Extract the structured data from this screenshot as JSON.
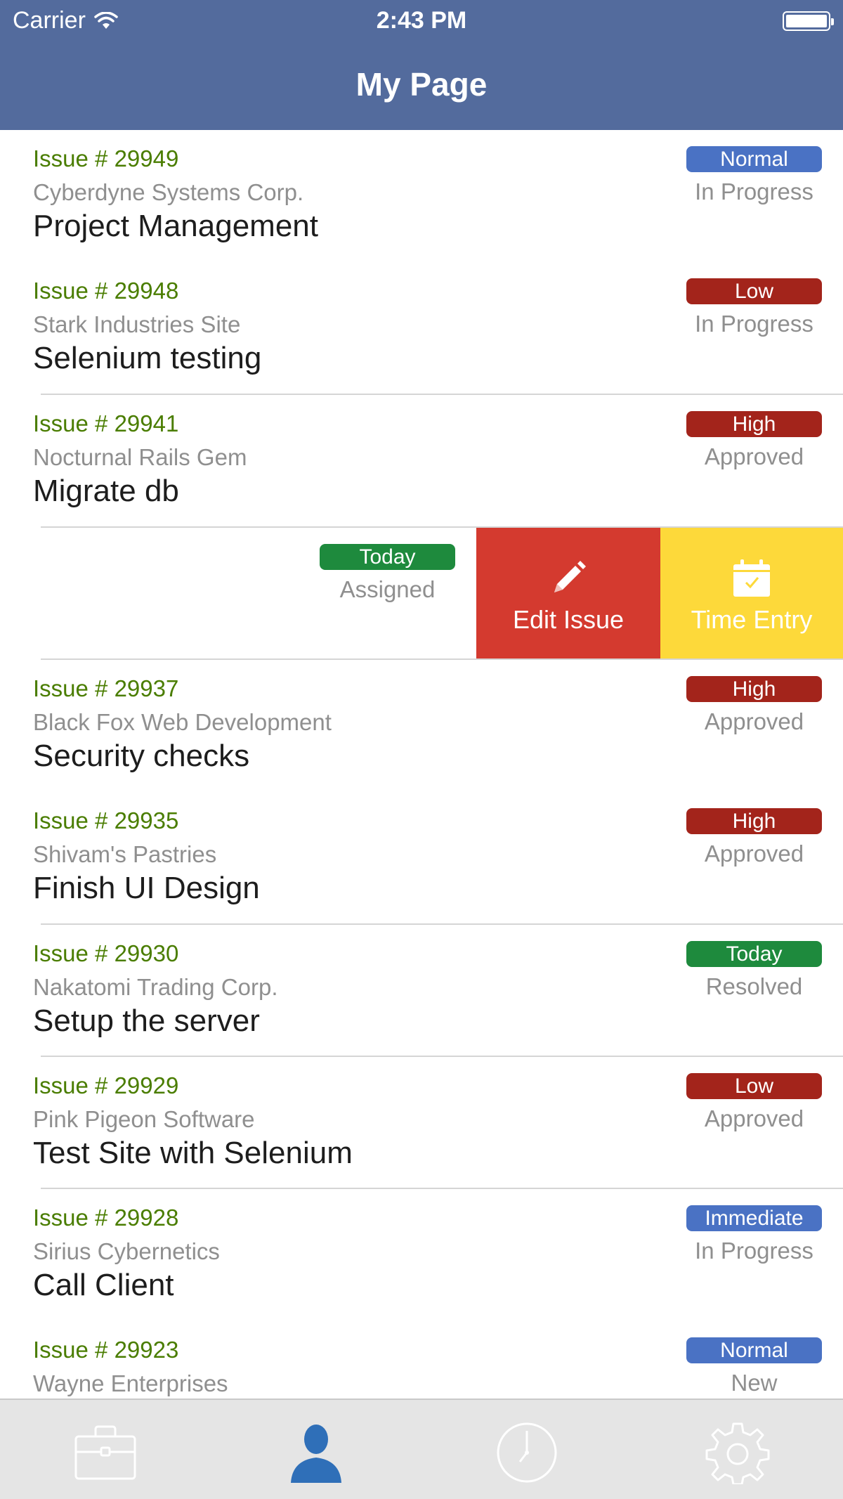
{
  "status_bar": {
    "carrier": "Carrier",
    "time": "2:43 PM"
  },
  "nav": {
    "title": "My Page"
  },
  "colors": {
    "header": "#536b9d",
    "issue_number": "#4a7d00",
    "badge_normal": "#4a72c4",
    "badge_low": "#a3241b",
    "badge_high": "#a3241b",
    "badge_today": "#1e8a3d",
    "badge_immediate": "#4a72c4",
    "edit_action": "#d43a2f",
    "time_action": "#fdd93a",
    "tab_active": "#2f6fb8",
    "tab_inactive": "#ffffff"
  },
  "issues": [
    {
      "number": "Issue # 29949",
      "company": "Cyberdyne Systems Corp.",
      "subject": "Project Management",
      "badge": "Normal",
      "badge_color": "#4a72c4",
      "status": "In Progress"
    },
    {
      "number": "Issue # 29948",
      "company": "Stark Industries Site",
      "subject": "Selenium testing",
      "badge": "Low",
      "badge_color": "#a3241b",
      "status": "In Progress"
    },
    {
      "number": "Issue # 29941",
      "company": "Nocturnal Rails Gem",
      "subject": "Migrate db",
      "badge": "High",
      "badge_color": "#a3241b",
      "status": "Approved"
    },
    {
      "badge": "Today",
      "badge_color": "#1e8a3d",
      "status": "Assigned",
      "swiped": true
    },
    {
      "number": "Issue # 29937",
      "company": "Black Fox Web Development",
      "subject": "Security checks",
      "badge": "High",
      "badge_color": "#a3241b",
      "status": "Approved"
    },
    {
      "number": "Issue # 29935",
      "company": "Shivam's Pastries",
      "subject": "Finish UI Design",
      "badge": "High",
      "badge_color": "#a3241b",
      "status": "Approved"
    },
    {
      "number": "Issue # 29930",
      "company": "Nakatomi Trading Corp.",
      "subject": "Setup the server",
      "badge": "Today",
      "badge_color": "#1e8a3d",
      "status": "Resolved"
    },
    {
      "number": "Issue # 29929",
      "company": "Pink Pigeon Software",
      "subject": "Test Site with Selenium",
      "badge": "Low",
      "badge_color": "#a3241b",
      "status": "Approved"
    },
    {
      "number": "Issue # 29928",
      "company": "Sirius Cybernetics",
      "subject": "Call Client",
      "badge": "Immediate",
      "badge_color": "#4a72c4",
      "status": "In Progress"
    },
    {
      "number": "Issue # 29923",
      "company": "Wayne Enterprises",
      "subject": "",
      "badge": "Normal",
      "badge_color": "#4a72c4",
      "status": "New"
    }
  ],
  "swipe_actions": {
    "edit_label": "Edit Issue",
    "time_label": "Time Entry"
  },
  "tabbar": {
    "tabs": [
      {
        "icon": "briefcase-icon",
        "active": false
      },
      {
        "icon": "person-icon",
        "active": true
      },
      {
        "icon": "clock-icon",
        "active": false
      },
      {
        "icon": "gear-icon",
        "active": false
      }
    ]
  }
}
